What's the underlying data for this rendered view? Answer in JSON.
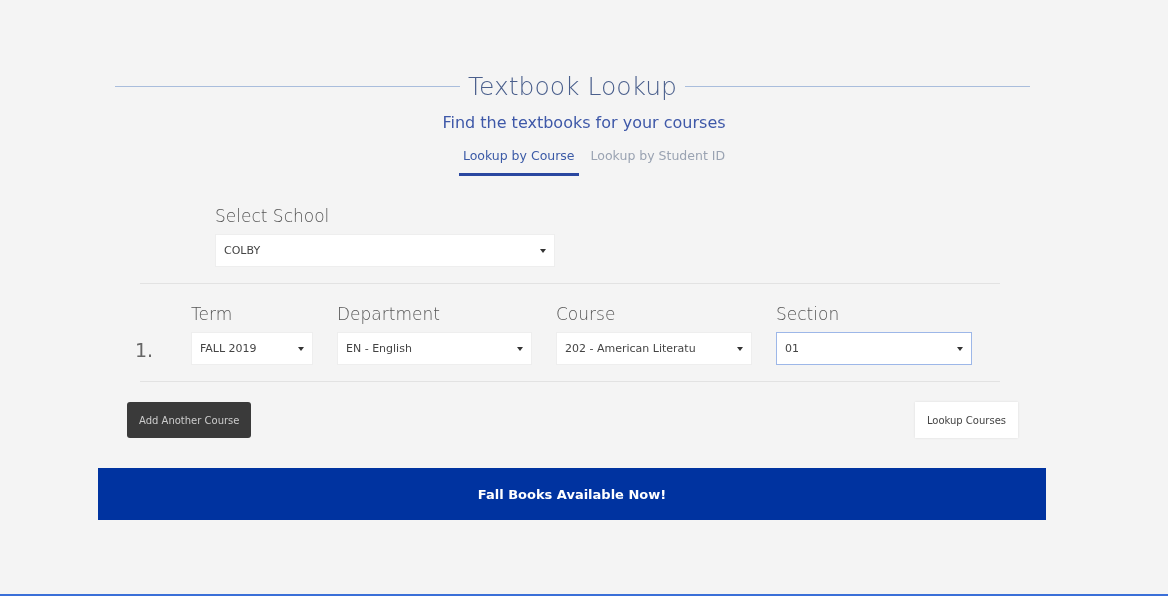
{
  "title": "Textbook Lookup",
  "subtitle": "Find the textbooks for your courses",
  "tabs": [
    {
      "label": "Lookup by Course",
      "selected": true
    },
    {
      "label": "Lookup by Student ID",
      "selected": false
    }
  ],
  "school": {
    "label": "Select School",
    "value": "COLBY"
  },
  "course_rows": [
    {
      "number": "1.",
      "fields": [
        {
          "label": "Term",
          "value": "FALL 2019",
          "focused": false
        },
        {
          "label": "Department",
          "value": "EN - English",
          "focused": false
        },
        {
          "label": "Course",
          "value": "202 - American Literatu",
          "focused": false
        },
        {
          "label": "Section",
          "value": "01",
          "focused": true
        }
      ]
    }
  ],
  "buttons": {
    "add": "Add Another Course",
    "lookup": "Lookup Courses"
  },
  "banner": "Fall Books Available Now!"
}
